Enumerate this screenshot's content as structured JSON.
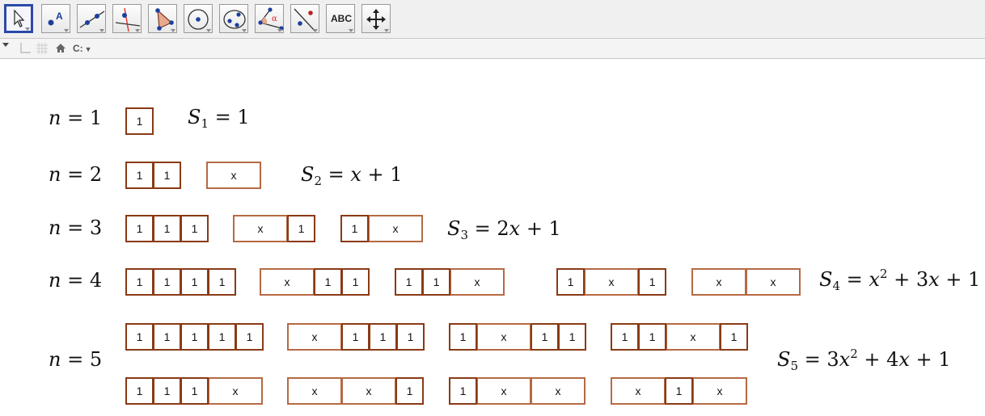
{
  "toolbar": {
    "tools": [
      {
        "name": "move",
        "icon": "cursor-arrow-icon",
        "selected": true
      },
      {
        "name": "point",
        "icon": "point-icon",
        "label": "A"
      },
      {
        "name": "line",
        "icon": "line-through-points-icon"
      },
      {
        "name": "perpendicular-line",
        "icon": "perpendicular-line-icon"
      },
      {
        "name": "polygon",
        "icon": "polygon-icon"
      },
      {
        "name": "circle-center-point",
        "icon": "circle-center-icon"
      },
      {
        "name": "conic",
        "icon": "ellipse-icon"
      },
      {
        "name": "angle",
        "icon": "angle-icon",
        "label": "α"
      },
      {
        "name": "reflect",
        "icon": "reflect-about-line-icon"
      },
      {
        "name": "text",
        "icon": "text-tool-icon",
        "label": "ABC"
      },
      {
        "name": "move-graphics-view",
        "icon": "move-view-icon"
      }
    ]
  },
  "stylebar": {
    "items": [
      "toggle-stylebar-icon",
      "axes-icon",
      "grid-icon",
      "home-icon"
    ],
    "point_capture_label": "C:"
  },
  "colors": {
    "tile_one_border": "#8a3a15",
    "tile_x_border": "#b56a44",
    "toolbar_selected": "#2b4aa8"
  },
  "canvas": {
    "tile_labels": {
      "one": "1",
      "x": "x"
    },
    "rows": [
      {
        "n": "1",
        "label": "n = 1",
        "sum": {
          "sub": "1",
          "expr": "1"
        },
        "patterns": [
          [
            "1"
          ]
        ]
      },
      {
        "n": "2",
        "label": "n = 2",
        "sum": {
          "sub": "2",
          "expr": "x + 1"
        },
        "patterns": [
          [
            "1",
            "1"
          ],
          [
            "x"
          ]
        ]
      },
      {
        "n": "3",
        "label": "n = 3",
        "sum": {
          "sub": "3",
          "expr": "2x + 1"
        },
        "patterns": [
          [
            "1",
            "1",
            "1"
          ],
          [
            "x",
            "1"
          ],
          [
            "1",
            "x"
          ]
        ]
      },
      {
        "n": "4",
        "label": "n = 4",
        "sum": {
          "sub": "4",
          "expr": "x² + 3x + 1"
        },
        "patterns": [
          [
            "1",
            "1",
            "1",
            "1"
          ],
          [
            "x",
            "1",
            "1"
          ],
          [
            "1",
            "1",
            "x"
          ],
          [
            "1",
            "x",
            "1"
          ],
          [
            "x",
            "x"
          ]
        ]
      },
      {
        "n": "5",
        "label": "n = 5",
        "sum": {
          "sub": "5",
          "expr": "3x² + 4x + 1"
        },
        "patterns": [
          [
            "1",
            "1",
            "1",
            "1",
            "1"
          ],
          [
            "x",
            "1",
            "1",
            "1"
          ],
          [
            "1",
            "x",
            "1",
            "1"
          ],
          [
            "1",
            "1",
            "x",
            "1"
          ],
          [
            "1",
            "1",
            "1",
            "x"
          ],
          [
            "x",
            "x",
            "1"
          ],
          [
            "1",
            "x",
            "x"
          ],
          [
            "x",
            "1",
            "x"
          ]
        ]
      }
    ]
  }
}
